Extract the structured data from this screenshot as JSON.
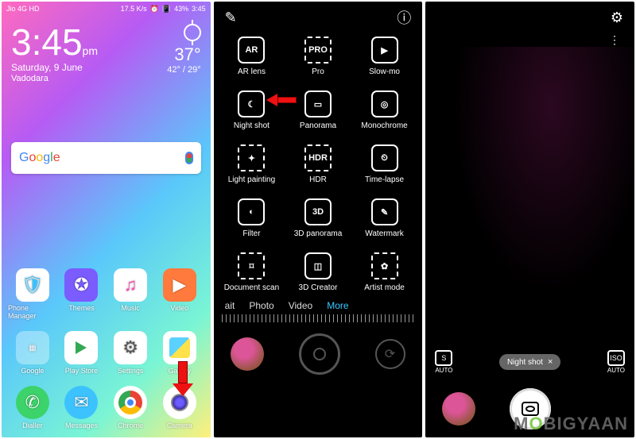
{
  "statusbar": {
    "carrier": "Jio 4G",
    "hd": "HD",
    "speed": "17.5 K/s",
    "alarm": "⏰",
    "vibrate": "📳",
    "battery": "43%",
    "time": "3:45"
  },
  "clock": {
    "time": "3:45",
    "ampm": "pm",
    "date": "Saturday, 9 June",
    "city": "Vadodara"
  },
  "weather": {
    "temp": "37°",
    "range": "42° / 29°"
  },
  "search": {
    "brand": "Google"
  },
  "apps_row1": [
    {
      "label": "Phone Manager"
    },
    {
      "label": "Themes"
    },
    {
      "label": "Music"
    },
    {
      "label": "Video"
    }
  ],
  "apps_row2": [
    {
      "label": "Google"
    },
    {
      "label": "Play Store"
    },
    {
      "label": "Settings"
    },
    {
      "label": "Gallery"
    }
  ],
  "dock": [
    {
      "label": "Dialler"
    },
    {
      "label": "Messages"
    },
    {
      "label": "Chrome"
    },
    {
      "label": "Camera"
    }
  ],
  "camera_modes": [
    {
      "label": "AR lens",
      "glyph": "AR"
    },
    {
      "label": "Pro",
      "glyph": "PRO"
    },
    {
      "label": "Slow-mo",
      "glyph": "▶"
    },
    {
      "label": "Night shot",
      "glyph": "☾"
    },
    {
      "label": "Panorama",
      "glyph": "▭"
    },
    {
      "label": "Monochrome",
      "glyph": "◎"
    },
    {
      "label": "Light painting",
      "glyph": "✦"
    },
    {
      "label": "HDR",
      "glyph": "HDR"
    },
    {
      "label": "Time-lapse",
      "glyph": "⏲"
    },
    {
      "label": "Filter",
      "glyph": "◐"
    },
    {
      "label": "3D panorama",
      "glyph": "3D"
    },
    {
      "label": "Watermark",
      "glyph": "✎"
    },
    {
      "label": "Document scan",
      "glyph": "⌑"
    },
    {
      "label": "3D Creator",
      "glyph": "◫"
    },
    {
      "label": "Artist mode",
      "glyph": "✿"
    }
  ],
  "tabs": {
    "t0": "ait",
    "t1": "Photo",
    "t2": "Video",
    "t3": "More"
  },
  "panel3": {
    "s_auto_label": "AUTO",
    "s_glyph": "S",
    "iso_glyph": "ISO",
    "iso_auto_label": "AUTO",
    "mode_pill": "Night shot",
    "close": "×"
  },
  "watermark": "MOBIGYAAN"
}
